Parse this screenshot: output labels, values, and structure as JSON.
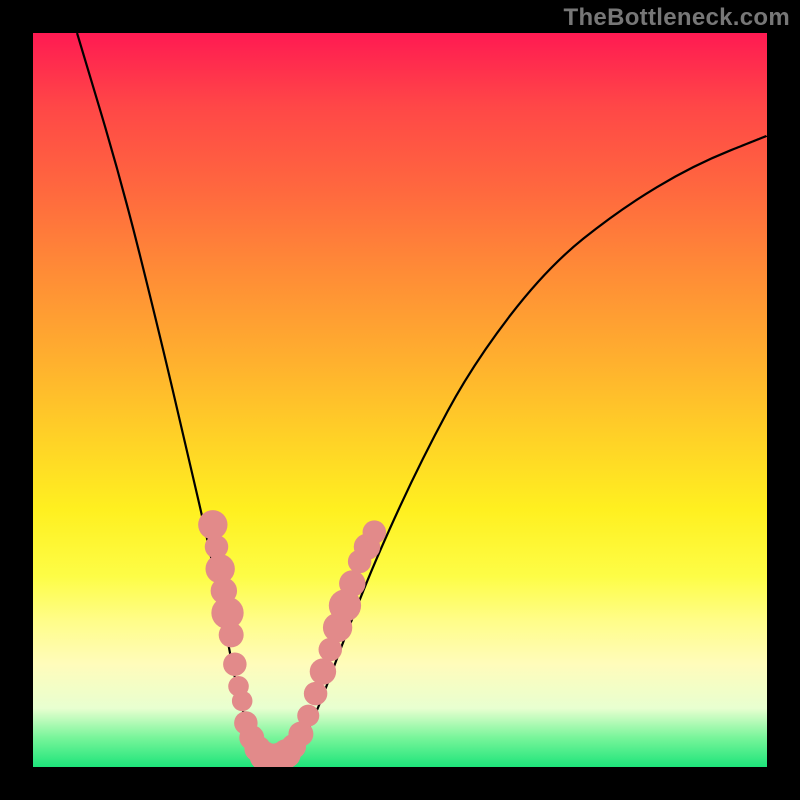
{
  "watermark": "TheBottleneck.com",
  "chart_data": {
    "type": "line",
    "title": "",
    "xlabel": "",
    "ylabel": "",
    "xlim": [
      0,
      100
    ],
    "ylim": [
      0,
      100
    ],
    "series": [
      {
        "name": "bottleneck-curve",
        "points": [
          {
            "x": 6,
            "y": 100
          },
          {
            "x": 12,
            "y": 80
          },
          {
            "x": 17,
            "y": 60
          },
          {
            "x": 21,
            "y": 43
          },
          {
            "x": 24,
            "y": 30
          },
          {
            "x": 26,
            "y": 20
          },
          {
            "x": 27.5,
            "y": 12
          },
          {
            "x": 29,
            "y": 6
          },
          {
            "x": 30.5,
            "y": 2.5
          },
          {
            "x": 32,
            "y": 1
          },
          {
            "x": 34,
            "y": 1
          },
          {
            "x": 36,
            "y": 2.5
          },
          {
            "x": 38,
            "y": 6
          },
          {
            "x": 40,
            "y": 11
          },
          {
            "x": 43,
            "y": 19
          },
          {
            "x": 47,
            "y": 29
          },
          {
            "x": 53,
            "y": 42
          },
          {
            "x": 60,
            "y": 55
          },
          {
            "x": 70,
            "y": 68
          },
          {
            "x": 80,
            "y": 76
          },
          {
            "x": 90,
            "y": 82
          },
          {
            "x": 100,
            "y": 86
          }
        ]
      }
    ],
    "scatter": [
      {
        "x": 24.5,
        "y": 33,
        "r": 2.0
      },
      {
        "x": 25.0,
        "y": 30,
        "r": 1.6
      },
      {
        "x": 25.5,
        "y": 27,
        "r": 2.0
      },
      {
        "x": 26.0,
        "y": 24,
        "r": 1.8
      },
      {
        "x": 26.5,
        "y": 21,
        "r": 2.2
      },
      {
        "x": 27.0,
        "y": 18,
        "r": 1.7
      },
      {
        "x": 27.5,
        "y": 14,
        "r": 1.6
      },
      {
        "x": 28.0,
        "y": 11,
        "r": 1.4
      },
      {
        "x": 28.5,
        "y": 9,
        "r": 1.4
      },
      {
        "x": 29.0,
        "y": 6,
        "r": 1.6
      },
      {
        "x": 29.8,
        "y": 4,
        "r": 1.7
      },
      {
        "x": 30.6,
        "y": 2.5,
        "r": 1.8
      },
      {
        "x": 31.5,
        "y": 1.5,
        "r": 2.0
      },
      {
        "x": 32.5,
        "y": 1.2,
        "r": 2.0
      },
      {
        "x": 33.5,
        "y": 1.3,
        "r": 2.0
      },
      {
        "x": 34.5,
        "y": 1.8,
        "r": 2.0
      },
      {
        "x": 35.5,
        "y": 2.8,
        "r": 1.7
      },
      {
        "x": 36.5,
        "y": 4.5,
        "r": 1.7
      },
      {
        "x": 37.5,
        "y": 7,
        "r": 1.5
      },
      {
        "x": 38.5,
        "y": 10,
        "r": 1.6
      },
      {
        "x": 39.5,
        "y": 13,
        "r": 1.8
      },
      {
        "x": 40.5,
        "y": 16,
        "r": 1.6
      },
      {
        "x": 41.5,
        "y": 19,
        "r": 2.0
      },
      {
        "x": 42.5,
        "y": 22,
        "r": 2.2
      },
      {
        "x": 43.5,
        "y": 25,
        "r": 1.8
      },
      {
        "x": 44.5,
        "y": 28,
        "r": 1.6
      },
      {
        "x": 45.5,
        "y": 30,
        "r": 1.8
      },
      {
        "x": 46.5,
        "y": 32,
        "r": 1.6
      }
    ]
  }
}
